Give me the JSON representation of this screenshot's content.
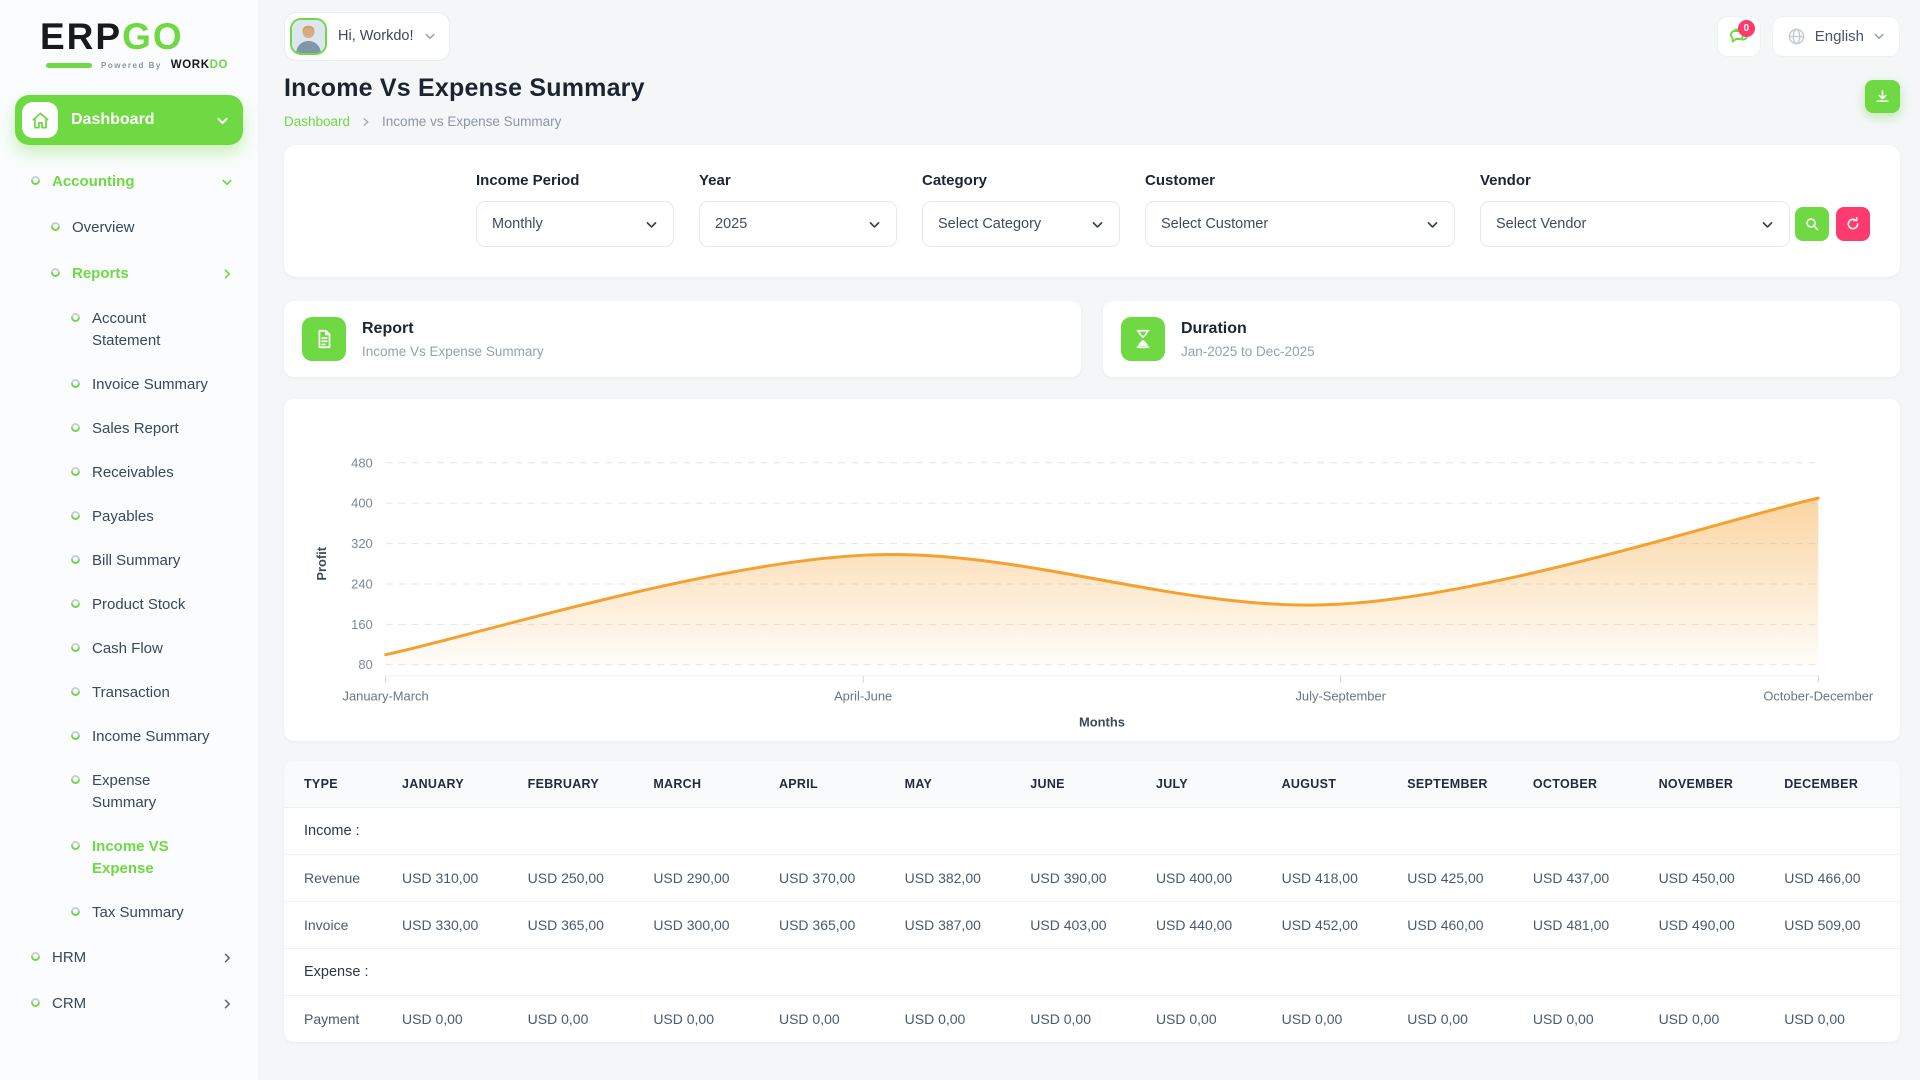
{
  "colors": {
    "primary": "#6fd943",
    "pink": "#ff3a6e",
    "chart_line": "#f6a12f"
  },
  "brand": {
    "name_black": "ERP",
    "name_green": "GO",
    "powered_by": "Powered By",
    "powered_brand_black": "WORK",
    "powered_brand_green": "DO"
  },
  "topbar": {
    "greeting": "Hi, Workdo!",
    "notification_badge": "0",
    "language": "English"
  },
  "sidebar": {
    "dashboard_label": "Dashboard",
    "accounting_label": "Accounting",
    "overview_label": "Overview",
    "reports_label": "Reports",
    "report_items": [
      "Account\nStatement",
      "Invoice Summary",
      "Sales Report",
      "Receivables",
      "Payables",
      "Bill Summary",
      "Product Stock",
      "Cash Flow",
      "Transaction",
      "Income Summary",
      "Expense\nSummary",
      "Income VS\nExpense",
      "Tax Summary"
    ],
    "active_report_item": "Income VS\nExpense",
    "hrm_label": "HRM",
    "crm_label": "CRM"
  },
  "page": {
    "title": "Income Vs Expense Summary",
    "breadcrumb_home": "Dashboard",
    "breadcrumb_current": "Income vs Expense Summary"
  },
  "filters": {
    "fields": [
      {
        "label": "Income Period",
        "value": "Monthly"
      },
      {
        "label": "Year",
        "value": "2025"
      },
      {
        "label": "Category",
        "value": "Select Category"
      },
      {
        "label": "Customer",
        "value": "Select Customer"
      },
      {
        "label": "Vendor",
        "value": "Select Vendor"
      }
    ]
  },
  "info_cards": {
    "report": {
      "title": "Report",
      "subtitle": "Income Vs Expense Summary"
    },
    "duration": {
      "title": "Duration",
      "subtitle": "Jan-2025 to Dec-2025"
    }
  },
  "chart_data": {
    "type": "area",
    "title": "",
    "categories": [
      "January-March",
      "April-June",
      "July-September",
      "October-December"
    ],
    "series": [
      {
        "name": "Profit",
        "values": [
          100,
          297,
          200,
          410
        ]
      }
    ],
    "xlabel": "Months",
    "ylabel": "Profit",
    "yticks": [
      80,
      160,
      240,
      320,
      400,
      480
    ],
    "ylim": [
      80,
      480
    ],
    "grid": "horizontal-dashed",
    "legend": "none",
    "line_color": "#f6a12f"
  },
  "table": {
    "columns": [
      "TYPE",
      "JANUARY",
      "FEBRUARY",
      "MARCH",
      "APRIL",
      "MAY",
      "JUNE",
      "JULY",
      "AUGUST",
      "SEPTEMBER",
      "OCTOBER",
      "NOVEMBER",
      "DECEMBER"
    ],
    "sections": [
      {
        "label": "Income :",
        "rows": [
          {
            "type": "Revenue",
            "values": [
              "USD 310,00",
              "USD 250,00",
              "USD 290,00",
              "USD 370,00",
              "USD 382,00",
              "USD 390,00",
              "USD 400,00",
              "USD 418,00",
              "USD 425,00",
              "USD 437,00",
              "USD 450,00",
              "USD 466,00"
            ]
          },
          {
            "type": "Invoice",
            "values": [
              "USD 330,00",
              "USD 365,00",
              "USD 300,00",
              "USD 365,00",
              "USD 387,00",
              "USD 403,00",
              "USD 440,00",
              "USD 452,00",
              "USD 460,00",
              "USD 481,00",
              "USD 490,00",
              "USD 509,00"
            ]
          }
        ]
      },
      {
        "label": "Expense :",
        "rows": [
          {
            "type": "Payment",
            "values": [
              "USD 0,00",
              "USD 0,00",
              "USD 0,00",
              "USD 0,00",
              "USD 0,00",
              "USD 0,00",
              "USD 0,00",
              "USD 0,00",
              "USD 0,00",
              "USD 0,00",
              "USD 0,00",
              "USD 0,00"
            ]
          }
        ]
      }
    ]
  }
}
